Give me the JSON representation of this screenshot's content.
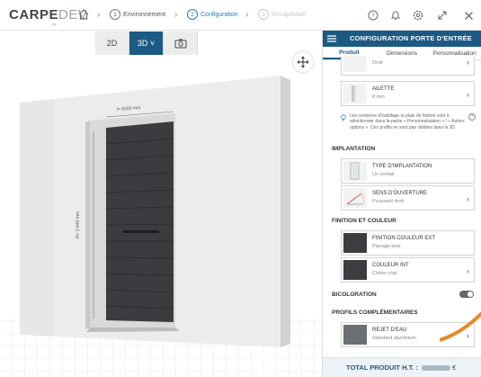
{
  "app": {
    "logo_main": "CARPE",
    "logo_accent": "DEV",
    "logo_sub": "by..."
  },
  "breadcrumb": {
    "steps": [
      {
        "num": "1",
        "label": "Environnement",
        "state": "done"
      },
      {
        "num": "2",
        "label": "Configuration",
        "state": "active"
      },
      {
        "num": "3",
        "label": "Récapitulatif",
        "state": "disabled"
      }
    ]
  },
  "viewer": {
    "buttons": [
      {
        "label": "2D"
      },
      {
        "label": "3D ˅"
      },
      {
        "label": ""
      }
    ],
    "active_mode": "3D",
    "dimension_width": "l= 8180 mm",
    "dimension_height": "H= 2 640 mm"
  },
  "panel": {
    "title": "CONFIGURATION PORTE D'ENTRÉE",
    "tabs": [
      {
        "label": "Produit"
      },
      {
        "label": "Dimensions"
      },
      {
        "label": "Personnalisation"
      }
    ],
    "active_tab": "Produit",
    "top_items": [
      {
        "title": "",
        "sub": "Droit"
      },
      {
        "title": "AILETTE",
        "sub": "8 mm"
      }
    ],
    "info_text": "Les cornières d'habillage et plats de finition sont à sélectionner dans la partie « Personnalisation » / « Autres options ». Ces profils ne sont pas visibles dans la 3D",
    "sections": {
      "implantation": "IMPLANTATION",
      "finition": "FINITION ET COULEUR",
      "bicoloration": "BICOLORATION",
      "profils": "PROFILS COMPLÉMENTAIRES"
    },
    "implantation_items": [
      {
        "title": "TYPE D'IMPLANTATION",
        "sub": "Un ventail"
      },
      {
        "title": "SENS D'OUVERTURE",
        "sub": "Poussant droit"
      }
    ],
    "finition_items": [
      {
        "title": "FINITION COULEUR EXT",
        "sub": "Placage bois"
      },
      {
        "title": "COULEUR  INT",
        "sub": "Chêne clair"
      }
    ],
    "profils_items": [
      {
        "title": "REJET D'EAU",
        "sub": "Standard aluminium"
      }
    ],
    "bicoloration_on": false,
    "footer_label": "TOTAL PRODUIT H.T. :",
    "footer_currency": "€"
  },
  "colors": {
    "brand": "#1c5a83",
    "active_step": "#1b7fbf",
    "accent_orange": "#e8892a"
  }
}
